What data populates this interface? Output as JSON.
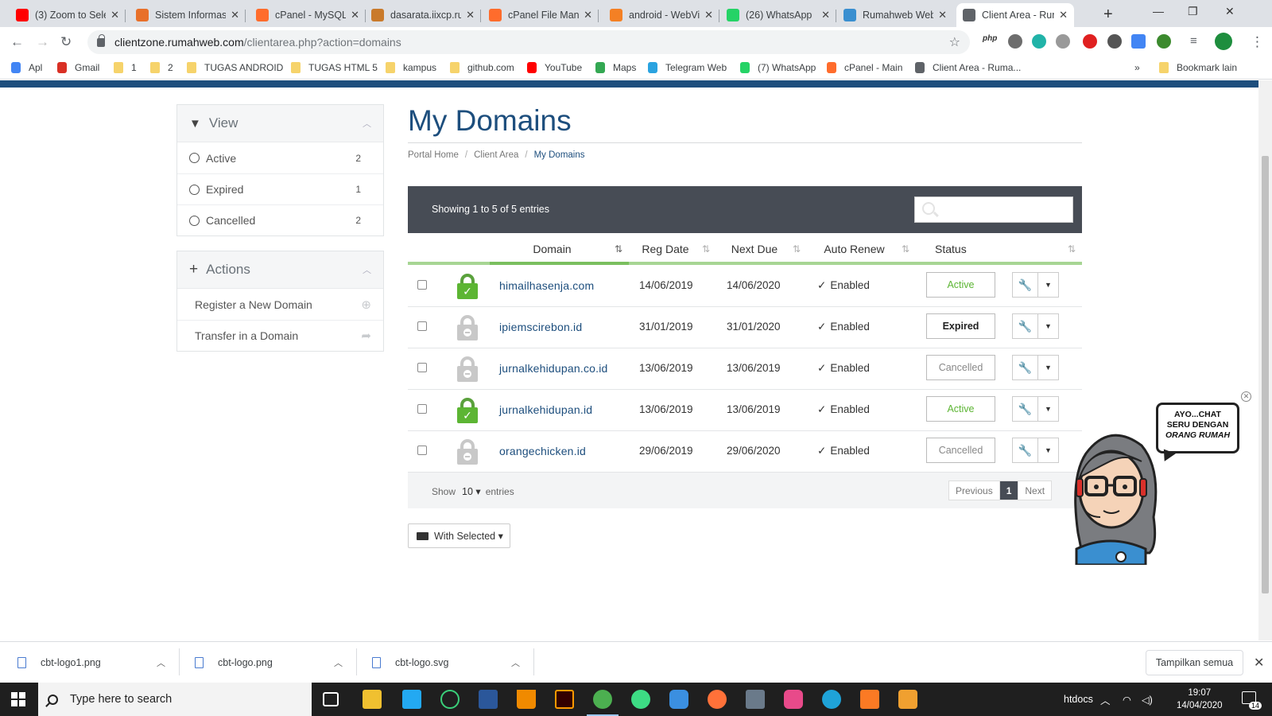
{
  "browser": {
    "tabs": [
      {
        "title": "(3) Zoom to Sele",
        "color": "#ff0000",
        "icon": "youtube-icon"
      },
      {
        "title": "Sistem Informasi",
        "color": "#e8702a",
        "icon": "xampp-icon"
      },
      {
        "title": "cPanel - MySQL®",
        "color": "#ff6c2c",
        "icon": "cpanel-icon"
      },
      {
        "title": "dasarata.iixcp.ru",
        "color": "#c97a2b",
        "icon": "site-icon"
      },
      {
        "title": "cPanel File Mana",
        "color": "#ff6c2c",
        "icon": "cpanel-icon"
      },
      {
        "title": "android - WebVi",
        "color": "#f48024",
        "icon": "stackoverflow-icon"
      },
      {
        "title": "(26) WhatsApp",
        "color": "#25d366",
        "icon": "whatsapp-icon"
      },
      {
        "title": "Rumahweb Web",
        "color": "#3a8fd0",
        "icon": "rumahweb-icon"
      },
      {
        "title": "Client Area - Rur",
        "color": "#5f6368",
        "icon": "globe-icon"
      }
    ],
    "url_host": "clientzone.rumahweb.com",
    "url_path": "/clientarea.php?action=domains",
    "bookmarks": [
      {
        "label": "Apl",
        "type": "apps"
      },
      {
        "label": "Gmail",
        "type": "gmail"
      },
      {
        "label": "1",
        "type": "folder"
      },
      {
        "label": "2",
        "type": "folder"
      },
      {
        "label": "TUGAS ANDROID",
        "type": "folder"
      },
      {
        "label": "TUGAS HTML 5",
        "type": "folder"
      },
      {
        "label": "kampus",
        "type": "folder"
      },
      {
        "label": "github.com",
        "type": "folder"
      },
      {
        "label": "YouTube",
        "type": "youtube"
      },
      {
        "label": "Maps",
        "type": "maps"
      },
      {
        "label": "Telegram Web",
        "type": "telegram"
      },
      {
        "label": "(7) WhatsApp",
        "type": "whatsapp"
      },
      {
        "label": "cPanel - Main",
        "type": "cpanel"
      },
      {
        "label": "Client Area - Ruma...",
        "type": "globe"
      }
    ],
    "bookmark_more": "»",
    "bookmark_other": "Bookmark lain"
  },
  "sidebar": {
    "view_title": "View",
    "filters": [
      {
        "label": "Active",
        "count": "2"
      },
      {
        "label": "Expired",
        "count": "1"
      },
      {
        "label": "Cancelled",
        "count": "2"
      }
    ],
    "actions_title": "Actions",
    "actions": [
      {
        "label": "Register a New Domain",
        "icon": "globe-icon"
      },
      {
        "label": "Transfer in a Domain",
        "icon": "share-arrow-icon"
      }
    ]
  },
  "main": {
    "title": "My Domains",
    "breadcrumb": [
      "Portal Home",
      "Client Area",
      "My Domains"
    ],
    "showing": "Showing 1 to 5 of 5 entries",
    "columns": [
      "Domain",
      "Reg Date",
      "Next Due",
      "Auto Renew",
      "Status"
    ],
    "rows": [
      {
        "domain": "himailhasenja.com",
        "reg": "14/06/2019",
        "due": "14/06/2020",
        "renew": "Enabled",
        "status": "Active",
        "lock": "green"
      },
      {
        "domain": "ipiemscirebon.id",
        "reg": "31/01/2019",
        "due": "31/01/2020",
        "renew": "Enabled",
        "status": "Expired",
        "lock": "grey"
      },
      {
        "domain": "jurnalkehidupan.co.id",
        "reg": "13/06/2019",
        "due": "13/06/2019",
        "renew": "Enabled",
        "status": "Cancelled",
        "lock": "grey"
      },
      {
        "domain": "jurnalkehidupan.id",
        "reg": "13/06/2019",
        "due": "13/06/2019",
        "renew": "Enabled",
        "status": "Active",
        "lock": "green"
      },
      {
        "domain": "orangechicken.id",
        "reg": "29/06/2019",
        "due": "29/06/2020",
        "renew": "Enabled",
        "status": "Cancelled",
        "lock": "grey"
      }
    ],
    "footer": {
      "show": "Show",
      "entries_value": "10",
      "entries": "entries",
      "prev": "Previous",
      "page": "1",
      "next": "Next"
    },
    "with_selected": "With Selected"
  },
  "chat": {
    "line1": "AYO...CHAT",
    "line2": "SERU DENGAN",
    "line3": "ORANG RUMAH"
  },
  "downloads": [
    {
      "name": "cbt-logo1.png"
    },
    {
      "name": "cbt-logo.png"
    },
    {
      "name": "cbt-logo.svg"
    }
  ],
  "download_show_all": "Tampilkan semua",
  "taskbar": {
    "search_placeholder": "Type here to search",
    "tray_label": "htdocs",
    "time": "19:07",
    "date": "14/04/2020",
    "notifications": "14"
  }
}
